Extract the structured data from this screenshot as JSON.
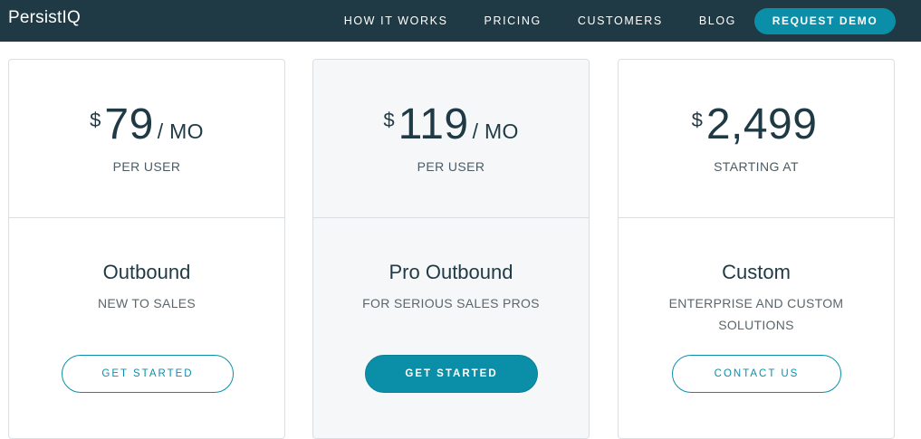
{
  "nav": {
    "logo": "PersistIQ",
    "links": [
      "HOW IT WORKS",
      "PRICING",
      "CUSTOMERS",
      "BLOG"
    ],
    "demo_button": "REQUEST DEMO"
  },
  "colors": {
    "nav_bg": "#1f3a45",
    "accent": "#0b8fa8",
    "featured_card_bg": "#f5f7f9"
  },
  "plans": [
    {
      "currency": "$",
      "amount": "79",
      "period": "/ MO",
      "price_sub": "PER USER",
      "name": "Outbound",
      "desc": "NEW TO SALES",
      "cta": "GET STARTED"
    },
    {
      "currency": "$",
      "amount": "119",
      "period": "/ MO",
      "price_sub": "PER USER",
      "name": "Pro Outbound",
      "desc": "FOR SERIOUS SALES PROS",
      "cta": "GET STARTED"
    },
    {
      "currency": "$",
      "amount": "2,499",
      "period": "",
      "price_sub": "STARTING AT",
      "name": "Custom",
      "desc": "ENTERPRISE AND CUSTOM SOLUTIONS",
      "cta": "CONTACT US"
    }
  ]
}
